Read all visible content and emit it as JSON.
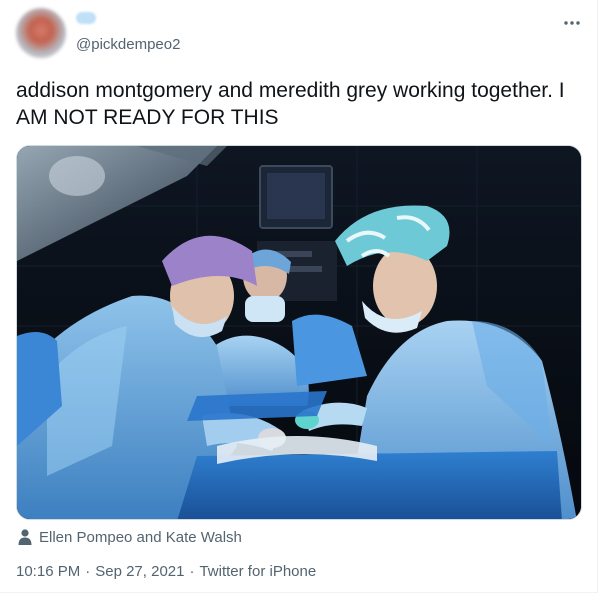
{
  "tweet": {
    "display_name": "",
    "handle": "@pickdempeo2",
    "more_icon": "more-options-icon",
    "text": "addison montgomery and meredith grey working together. I AM NOT READY FOR THIS",
    "media": {
      "icon": "surgery-photo",
      "caption": "Ellen Pompeo and Kate Walsh",
      "caption_icon": "person-icon"
    },
    "time": "10:16 PM",
    "date": "Sep 27, 2021",
    "separator": "·",
    "source": "Twitter for iPhone"
  },
  "colors": {
    "text": "#0f1419",
    "secondary": "#536471",
    "border": "#cfd9de"
  }
}
